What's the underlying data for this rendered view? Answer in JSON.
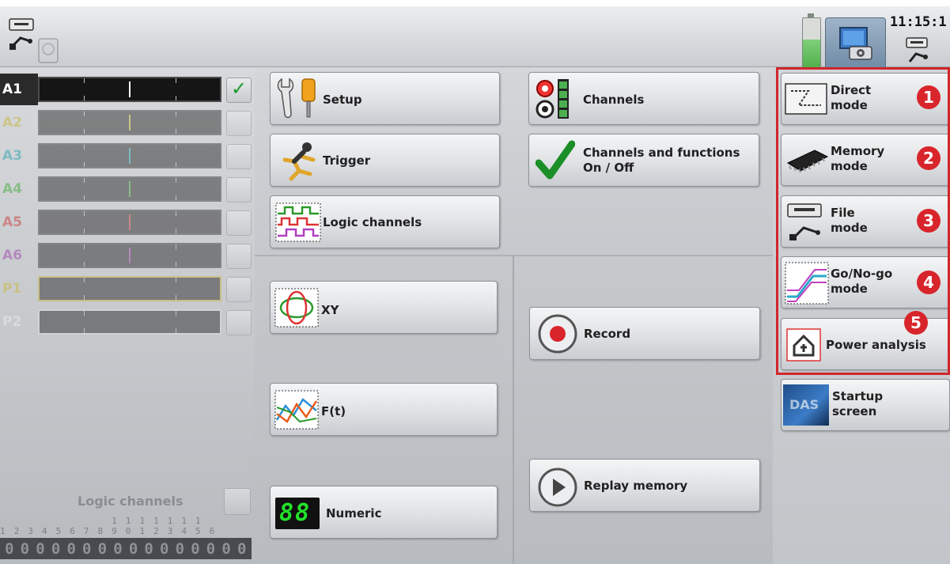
{
  "status_bar": {
    "clock": "11:15:1",
    "icons": [
      "usb-drive-icon",
      "hard-disk-icon",
      "battery-icon",
      "screenshot-camera-icon",
      "usb-drive-icon"
    ]
  },
  "channels": [
    {
      "label": "A1",
      "color": "#ffffff",
      "checked": true,
      "check_mark": "✓"
    },
    {
      "label": "A2",
      "color": "#c8b84a",
      "checked": false,
      "check_mark": ""
    },
    {
      "label": "A3",
      "color": "#3aa6b0",
      "checked": false,
      "check_mark": ""
    },
    {
      "label": "A4",
      "color": "#4fae4a",
      "checked": false,
      "check_mark": ""
    },
    {
      "label": "A5",
      "color": "#c94a4a",
      "checked": false,
      "check_mark": ""
    },
    {
      "label": "A6",
      "color": "#a050b0",
      "checked": false,
      "check_mark": ""
    },
    {
      "label": "P1",
      "color": "#c8b84a",
      "checked": false,
      "check_mark": ""
    },
    {
      "label": "P2",
      "color": "#a0a4a8",
      "checked": false,
      "check_mark": ""
    }
  ],
  "logic_panel": {
    "label": "Logic channels",
    "tens_row": "                1 1 1 1 1 1 1",
    "ones_row": "1 2 3 4 5 6 7 8 9 0 1 2 3 4 5 6",
    "bits": [
      "0",
      "0",
      "0",
      "0",
      "0",
      "0",
      "0",
      "0",
      "0",
      "0",
      "0",
      "0",
      "0",
      "0",
      "0",
      "0"
    ]
  },
  "menu": {
    "setup": "Setup",
    "trigger": "Trigger",
    "logic_channels": "Logic channels",
    "channels": "Channels",
    "channels_functions": "Channels and functions\nOn / Off",
    "xy": "XY",
    "ft": "F(t)",
    "numeric": "Numeric",
    "numeric_display": "88",
    "record": "Record",
    "replay": "Replay memory"
  },
  "modes": [
    {
      "label": "Direct\nmode",
      "badge": "1"
    },
    {
      "label": "Memory\nmode",
      "badge": "2"
    },
    {
      "label": "File\nmode",
      "badge": "3"
    },
    {
      "label": "Go/No-go\nmode",
      "badge": "4"
    },
    {
      "label": "Power analysis",
      "badge": "5"
    }
  ],
  "startup": {
    "label": "Startup\nscreen",
    "logo_text": "DAS"
  },
  "colors": {
    "highlight": "#d0262c",
    "badge": "#d8252b"
  }
}
